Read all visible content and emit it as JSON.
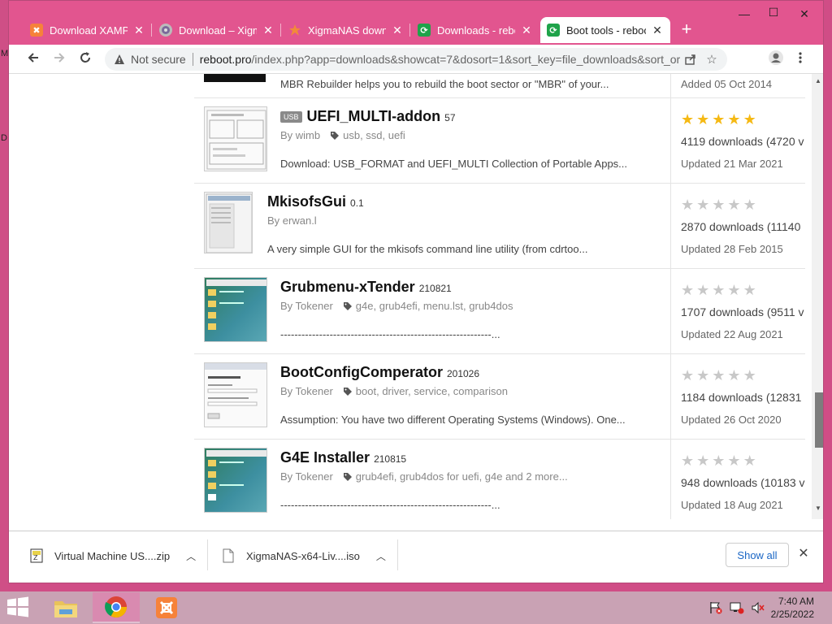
{
  "desktop": {
    "edge_letters": [
      "M",
      "D"
    ]
  },
  "browser": {
    "tabs": [
      {
        "title": "Download XAMPP",
        "favicon": "xampp-icon",
        "active": false
      },
      {
        "title": "Download – Xigma",
        "favicon": "xigma-icon",
        "active": false
      },
      {
        "title": "XigmaNAS downl",
        "favicon": "xigmanas-icon",
        "active": false
      },
      {
        "title": "Downloads - rebo",
        "favicon": "reboot-icon",
        "active": false
      },
      {
        "title": "Boot tools - reboo",
        "favicon": "reboot-icon",
        "active": true
      }
    ],
    "window_controls": {
      "minimize": "—",
      "maximize": "☐",
      "close": "✕"
    },
    "address": {
      "security_label": "Not secure",
      "url_host": "reboot.pro",
      "url_path": "/index.php?app=downloads&showcat=7&dosort=1&sort_key=file_downloads&sort_or..."
    }
  },
  "downloads_list": {
    "top_partial": {
      "description": "MBR Rebuilder helps you to rebuild the boot sector or \"MBR\" of your...",
      "updated": "Added 05 Oct 2014"
    },
    "items": [
      {
        "badge": "USB",
        "title": "UEFI_MULTI-addon",
        "version": "57",
        "author": "By wimb",
        "tags": "usb, ssd, uefi",
        "description": "Download: USB_FORMAT and UEFI_MULTI Collection of Portable Apps...",
        "rating": 5,
        "downloads": "4119 downloads (4720 v",
        "updated": "Updated 21 Mar 2021",
        "thumb": "form"
      },
      {
        "badge": "",
        "title": "MkisofsGui",
        "version": "0.1",
        "author": "By erwan.l",
        "tags": "",
        "description": "A very simple GUI for the mkisofs command line utility (from cdrtoo...",
        "rating": 0,
        "downloads": "2870 downloads (11140",
        "updated": "Updated 28 Feb 2015",
        "thumb": "gray"
      },
      {
        "badge": "",
        "title": "Grubmenu-xTender",
        "version": "210821",
        "author": "By Tokener",
        "tags": "g4e, grub4efi, menu.lst, grub4dos",
        "description": "------------------------------------------------------------...",
        "rating": 0,
        "downloads": "1707 downloads (9511 v",
        "updated": "Updated 22 Aug 2021",
        "thumb": "green"
      },
      {
        "badge": "",
        "title": "BootConfigComperator",
        "version": "201026",
        "author": "By Tokener",
        "tags": "boot, driver, service, comparison",
        "description": "Assumption: You have two different Operating Systems (Windows). One...",
        "rating": 0,
        "downloads": "1184 downloads (12831",
        "updated": "Updated 26 Oct 2020",
        "thumb": "config"
      },
      {
        "badge": "",
        "title": "G4E Installer",
        "version": "210815",
        "author": "By Tokener",
        "tags": "grub4efi, grub4dos for uefi, g4e and 2 more...",
        "description": "------------------------------------------------------------...",
        "rating": 0,
        "downloads": "948 downloads (10183 v",
        "updated": "Updated 18 Aug 2021",
        "thumb": "green"
      }
    ]
  },
  "download_bar": {
    "items": [
      {
        "name": "Virtual Machine US....zip",
        "icon": "zip-file-icon"
      },
      {
        "name": "XigmaNAS-x64-Liv....iso",
        "icon": "iso-file-icon"
      }
    ],
    "show_all": "Show all"
  },
  "taskbar": {
    "time": "7:40 AM",
    "date": "2/25/2022"
  },
  "colors": {
    "tabstrip": "#e2558f",
    "star_on": "#f5b914",
    "star_off": "#c8c8c8",
    "link": "#1a66c5"
  }
}
